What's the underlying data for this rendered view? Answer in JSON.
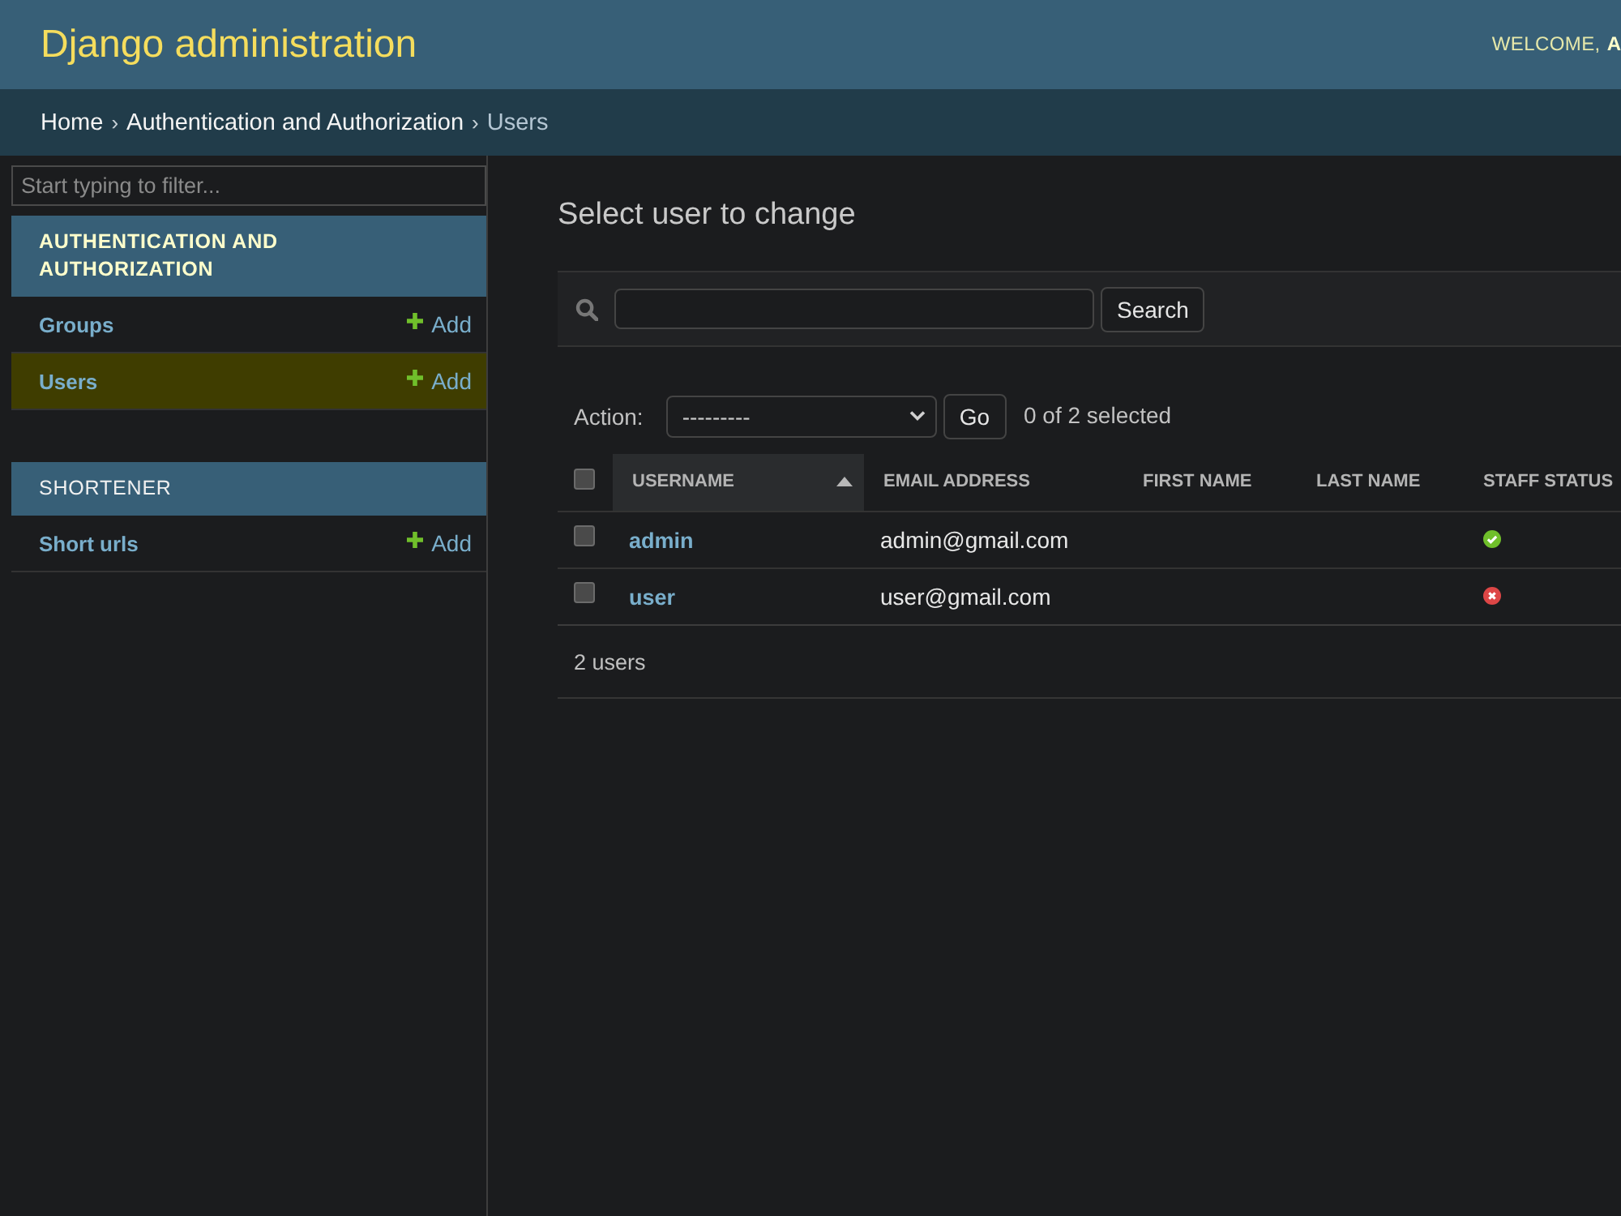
{
  "header": {
    "title": "Django administration",
    "welcome": "WELCOME,",
    "user": "A"
  },
  "breadcrumbs": [
    {
      "label": "Home",
      "current": false
    },
    {
      "separator": "›",
      "label": "Authentication and Authorization",
      "current": false
    },
    {
      "separator": "›",
      "label": "Users",
      "current": true
    }
  ],
  "sidebar": {
    "filter_placeholder": "Start typing to filter...",
    "modules": [
      {
        "caption": "AUTHENTICATION AND AUTHORIZATION",
        "current": true,
        "models": [
          {
            "name": "Groups",
            "add": "Add",
            "selected": false
          },
          {
            "name": "Users",
            "add": "Add",
            "selected": true
          }
        ]
      },
      {
        "caption": "SHORTENER",
        "current": false,
        "models": [
          {
            "name": "Short urls",
            "add": "Add",
            "selected": false
          }
        ]
      }
    ]
  },
  "main": {
    "title": "Select user to change",
    "search": {
      "button": "Search"
    },
    "actions": {
      "label": "Action:",
      "value": "---------",
      "button": "Go",
      "counter": "0 of 2 selected"
    }
  },
  "table": {
    "select_all_checked": false,
    "columns": [
      {
        "label": "USERNAME",
        "sorted": true
      },
      {
        "label": "EMAIL ADDRESS",
        "sorted": false
      },
      {
        "label": "FIRST NAME",
        "sorted": false
      },
      {
        "label": "LAST NAME",
        "sorted": false
      },
      {
        "label": "STAFF STATUS",
        "sorted": false
      }
    ],
    "rows": [
      {
        "checked": false,
        "username": "admin",
        "email": "admin@gmail.com",
        "staff_status": true
      },
      {
        "checked": false,
        "username": "user",
        "email": "user@gmail.com",
        "staff_status": false
      }
    ],
    "footer": "2 users"
  }
}
